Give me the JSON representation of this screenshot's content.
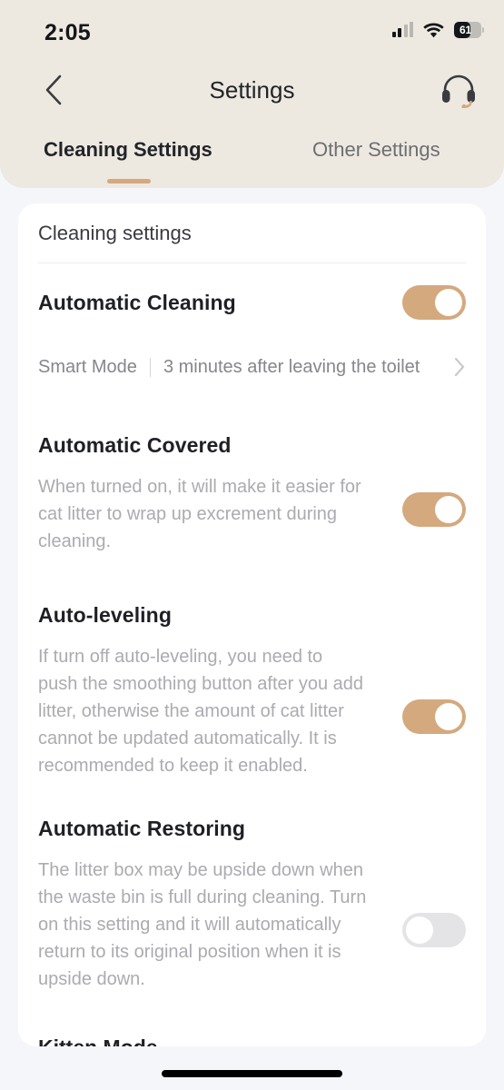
{
  "status_bar": {
    "time": "2:05",
    "cellular_icon": "cellular-signal-icon",
    "wifi_icon": "wifi-icon",
    "battery_icon": "battery-icon",
    "battery_percent": "61"
  },
  "nav": {
    "back_icon": "chevron-left-icon",
    "title": "Settings",
    "support_icon": "headset-icon"
  },
  "tabs": [
    {
      "label": "Cleaning Settings",
      "active": true
    },
    {
      "label": "Other Settings",
      "active": false
    }
  ],
  "card": {
    "title": "Cleaning settings",
    "rows": [
      {
        "title": "Automatic Cleaning",
        "toggle": "on",
        "subrow": {
          "mode": "Smart Mode",
          "detail": "3 minutes after leaving the toilet",
          "chevron_icon": "chevron-right-icon"
        }
      },
      {
        "title": "Automatic Covered",
        "description": "When turned on, it will make it easier for cat litter to wrap up excrement during cleaning.",
        "toggle": "on"
      },
      {
        "title": "Auto-leveling",
        "description": "If turn off auto-leveling, you need to push the smoothing button after you add litter, otherwise the amount of cat litter cannot be updated automatically. It is recommended to keep it enabled.",
        "toggle": "on"
      },
      {
        "title": "Automatic Restoring",
        "description": "The litter box may be upside down when the waste bin is full during cleaning. Turn on this setting and it will automatically return to its original position when it is upside down.",
        "toggle": "off"
      }
    ],
    "clipped_row_title": "Kitten Mode"
  },
  "home_indicator": "home-indicator",
  "colors": {
    "header_bg": "#EDE9E0",
    "page_bg": "#F5F6FA",
    "card_bg": "#FFFFFF",
    "accent": "#D4A97E",
    "toggle_off": "#E4E4E6",
    "title_text": "#1F2026",
    "muted_text": "#ABABB0"
  }
}
